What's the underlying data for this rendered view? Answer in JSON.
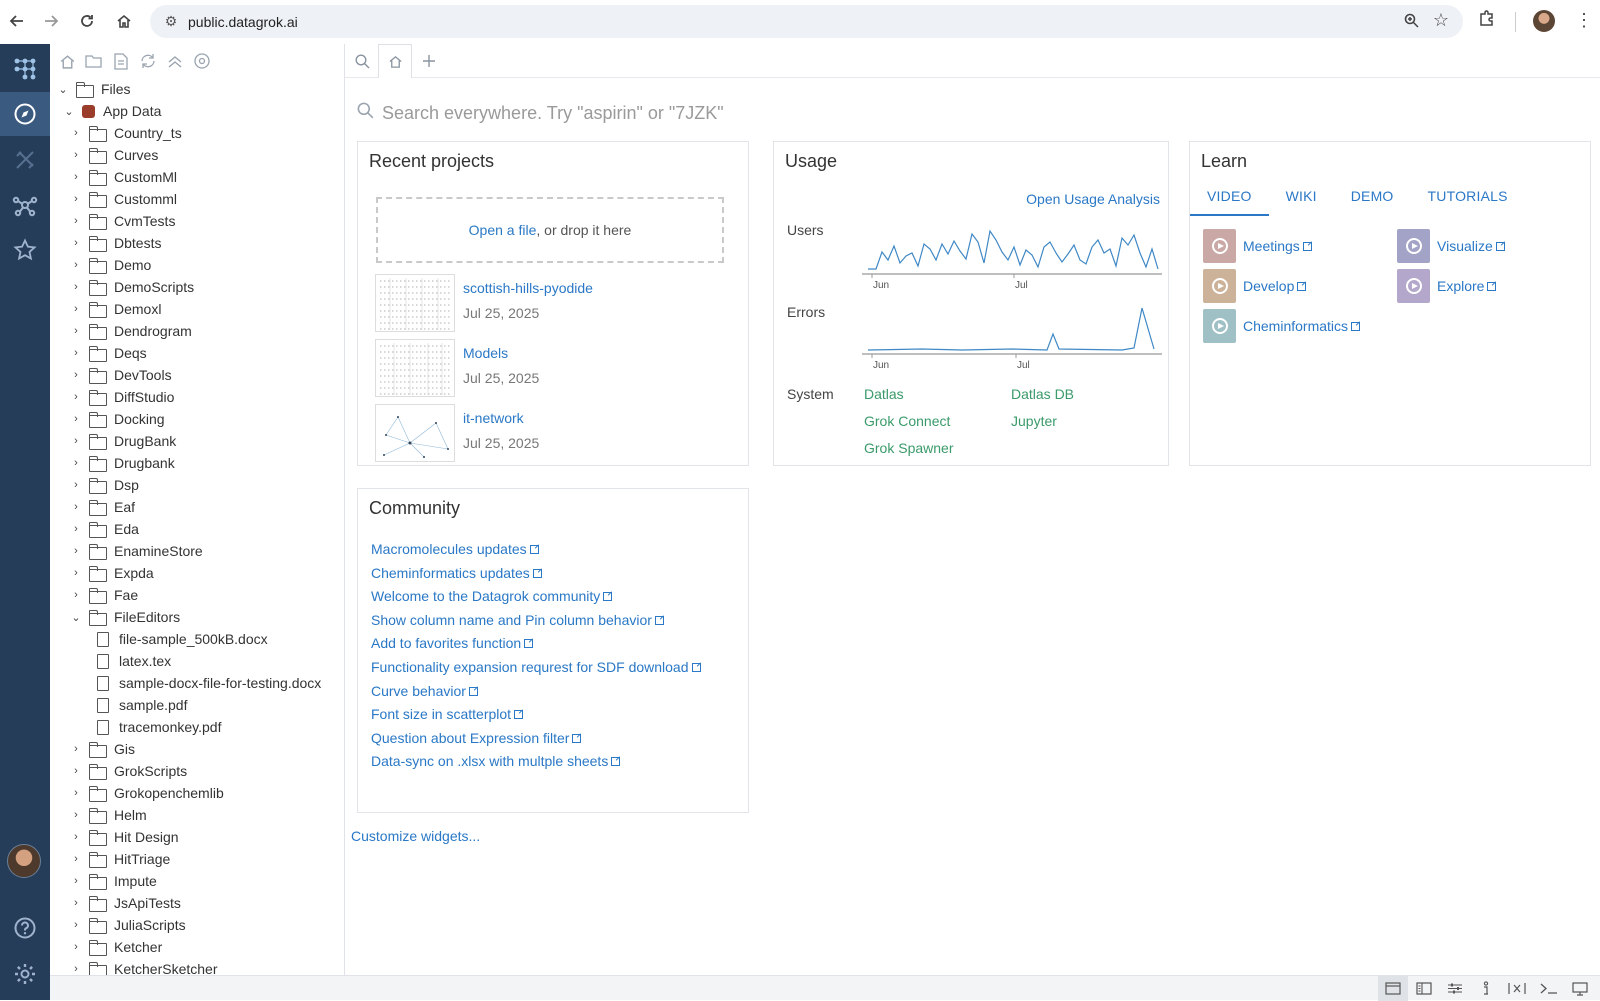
{
  "browser": {
    "url": "public.datagrok.ai"
  },
  "filetree": {
    "root": "Files",
    "appdata": "App Data",
    "folders_top": [
      "Country_ts",
      "Curves",
      "CustomMl",
      "Customml",
      "CvmTests",
      "Dbtests",
      "Demo",
      "DemoScripts",
      "Demoxl",
      "Dendrogram",
      "Deqs",
      "DevTools",
      "DiffStudio",
      "Docking",
      "DrugBank",
      "Drugbank",
      "Dsp",
      "Eaf",
      "Eda",
      "EnamineStore",
      "Expda",
      "Fae"
    ],
    "expanded_folder": "FileEditors",
    "files": [
      "file-sample_500kB.docx",
      "latex.tex",
      "sample-docx-file-for-testing.docx",
      "sample.pdf",
      "tracemonkey.pdf"
    ],
    "folders_bottom": [
      "Gis",
      "GrokScripts",
      "Grokopenchemlib",
      "Helm",
      "Hit Design",
      "HitTriage",
      "Impute",
      "JsApiTests",
      "JuliaScripts",
      "Ketcher",
      "KetcherSketcher"
    ]
  },
  "search": {
    "placeholder": "Search everywhere. Try \"aspirin\" or \"7JZK\""
  },
  "recent": {
    "title": "Recent projects",
    "open_link": "Open a file",
    "drop_text": ", or drop it here",
    "projects": [
      {
        "name": "scottish-hills-pyodide",
        "date": "Jul 25, 2025"
      },
      {
        "name": "Models",
        "date": "Jul 25, 2025"
      },
      {
        "name": "it-network",
        "date": "Jul 25, 2025"
      }
    ]
  },
  "usage": {
    "title": "Usage",
    "link": "Open Usage Analysis",
    "users_label": "Users",
    "errors_label": "Errors",
    "system_label": "System",
    "axis": [
      "Jun",
      "Jul"
    ],
    "systems": [
      "Datlas",
      "Datlas DB",
      "Grok Connect",
      "Jupyter",
      "Grok Spawner"
    ],
    "accent": "#3a9a6a"
  },
  "learn": {
    "title": "Learn",
    "tabs": [
      "VIDEO",
      "WIKI",
      "DEMO",
      "TUTORIALS"
    ],
    "videos": [
      {
        "label": "Meetings",
        "color": "#c9a8a5"
      },
      {
        "label": "Visualize",
        "color": "#a3a3c7"
      },
      {
        "label": "Develop",
        "color": "#cdb29a"
      },
      {
        "label": "Explore",
        "color": "#b3a8cc"
      },
      {
        "label": "Cheminformatics",
        "color": "#9fc0c4"
      }
    ]
  },
  "community": {
    "title": "Community",
    "links": [
      "Macromolecules updates",
      "Cheminformatics updates",
      "Welcome to the Datagrok community",
      "Show column name and Pin column behavior",
      "Add to favorites function",
      "Functionality expansion requrest for SDF download",
      "Curve behavior",
      "Font size in scatterplot",
      "Question about Expression filter",
      "Data-sync on .xlsx with multple sheets"
    ]
  },
  "customize": "Customize widgets...",
  "colors": {
    "rail": "#263d5a",
    "link": "#2a78c6"
  }
}
